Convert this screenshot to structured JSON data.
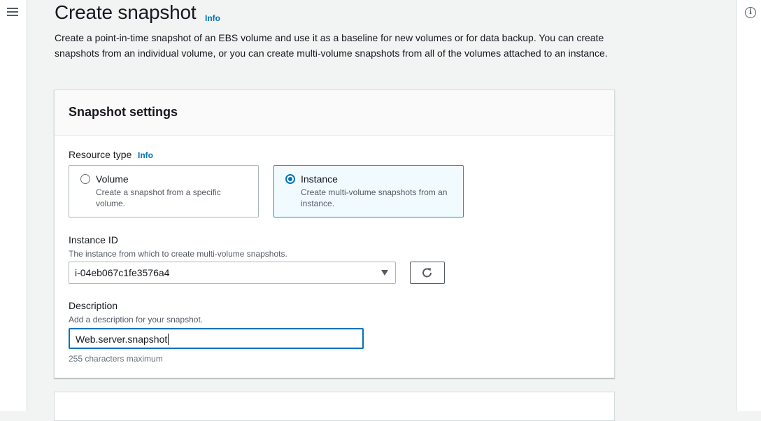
{
  "page": {
    "title": "Create snapshot",
    "title_info": "Info",
    "description": "Create a point-in-time snapshot of an EBS volume and use it as a baseline for new volumes or for data backup. You can create snapshots from an individual volume, or you can create multi-volume snapshots from all of the volumes attached to an instance."
  },
  "settings": {
    "title": "Snapshot settings",
    "resource_type": {
      "label": "Resource type",
      "info": "Info",
      "options": [
        {
          "label": "Volume",
          "description": "Create a snapshot from a specific volume.",
          "selected": false
        },
        {
          "label": "Instance",
          "description": "Create multi-volume snapshots from an instance.",
          "selected": true
        }
      ]
    },
    "instance_id": {
      "label": "Instance ID",
      "description": "The instance from which to create multi-volume snapshots.",
      "value": "i-04eb067c1fe3576a4"
    },
    "description_field": {
      "label": "Description",
      "description": "Add a description for your snapshot.",
      "value": "Web.server.snapshot",
      "constraint": "255 characters maximum"
    }
  },
  "icons": {
    "menu": "hamburger-menu-icon",
    "tools": "info-circle-icon",
    "refresh": "refresh-icon",
    "dropdown": "caret-down-icon"
  },
  "colors": {
    "accent": "#0073bb",
    "selected_tile_bg": "#f1faff",
    "selected_tile_border": "#00a1c9"
  }
}
